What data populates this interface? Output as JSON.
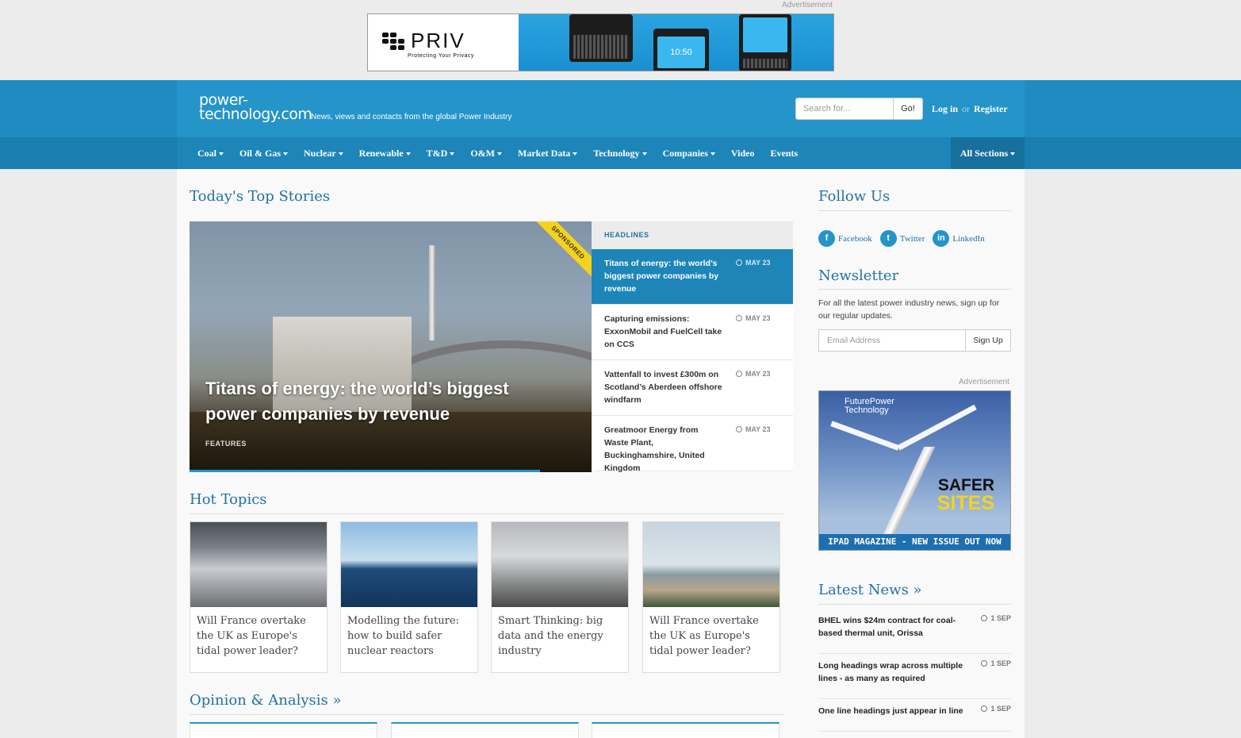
{
  "ad": {
    "label": "Advertisement",
    "brand": "PRIV",
    "tagline": "Protecting Your Privacy",
    "phone_time": "10:50"
  },
  "header": {
    "logo_line1": "power-",
    "logo_line2": "technology.com",
    "tagline": "News, views and contacts from the global Power Industry",
    "search_placeholder": "Search for...",
    "go_label": "Go!",
    "login": "Log in",
    "or": "or",
    "register": "Register"
  },
  "nav": {
    "items": [
      {
        "label": "Coal",
        "dropdown": true
      },
      {
        "label": "Oil & Gas",
        "dropdown": true
      },
      {
        "label": "Nuclear",
        "dropdown": true
      },
      {
        "label": "Renewable",
        "dropdown": true
      },
      {
        "label": "T&D",
        "dropdown": true
      },
      {
        "label": "O&M",
        "dropdown": true
      },
      {
        "label": "Market Data",
        "dropdown": true
      },
      {
        "label": "Technology",
        "dropdown": true
      },
      {
        "label": "Companies",
        "dropdown": true
      },
      {
        "label": "Video",
        "dropdown": false
      },
      {
        "label": "Events",
        "dropdown": false
      }
    ],
    "all_sections": "All Sections"
  },
  "main": {
    "top_stories_title": "Today's Top Stories",
    "hero": {
      "title": "Titans of energy: the world’s biggest power companies by revenue",
      "category": "FEATURES",
      "badge": "SPONSORED"
    },
    "headlines": {
      "heading": "HEADLINES",
      "items": [
        {
          "title": "Titans of energy: the world’s biggest power companies by revenue",
          "date": "MAY 23",
          "active": true
        },
        {
          "title": "Capturing emissions: ExxonMobil and FuelCell take on CCS",
          "date": "MAY 23",
          "active": false
        },
        {
          "title": "Vattenfall to invest £300m on Scotland’s Aberdeen offshore windfarm",
          "date": "MAY 23",
          "active": false
        },
        {
          "title": "Greatmoor Energy from Waste Plant, Buckinghamshire, United Kingdom",
          "date": "MAY 23",
          "active": false
        }
      ]
    },
    "hot_topics_title": "Hot Topics",
    "hot_topics": [
      {
        "title": "Will France overtake the UK as Europe's tidal power leader?"
      },
      {
        "title": "Modelling the future: how to build safer nuclear reactors"
      },
      {
        "title": "Smart Thinking: big data and the energy industry"
      },
      {
        "title": "Will France overtake the UK as Europe's tidal power leader?"
      }
    ],
    "opinion_title": "Opinion & Analysis »"
  },
  "sidebar": {
    "follow_title": "Follow Us",
    "social": [
      {
        "label": "Facebook",
        "icon": "facebook-icon",
        "glyph": "f"
      },
      {
        "label": "Twitter",
        "icon": "twitter-icon",
        "glyph": "t"
      },
      {
        "label": "LinkedIn",
        "icon": "linkedin-icon",
        "glyph": "in"
      }
    ],
    "newsletter_title": "Newsletter",
    "newsletter_text": "For all the latest power industry news, sign up for our regular updates.",
    "email_placeholder": "Email Address",
    "signup_label": "Sign Up",
    "ad_label": "Advertisement",
    "magazine": {
      "brand_line1": "FuturePower",
      "brand_line2": "Technology",
      "headline1": "SAFER",
      "headline2": "SITES",
      "banner": "IPAD MAGAZINE - NEW ISSUE OUT NOW"
    },
    "latest_title": "Latest News »",
    "latest": [
      {
        "title": "BHEL wins $24m contract for coal-based thermal unit, Orissa",
        "date": "1 SEP"
      },
      {
        "title": "Long headings wrap across multiple lines - as many as required",
        "date": "1 SEP"
      },
      {
        "title": "One line headings just appear in line",
        "date": "1 SEP"
      }
    ]
  },
  "colors": {
    "brand_blue": "#2494c9",
    "nav_blue": "#1d85b8",
    "title_blue": "#2272a6",
    "sponsored_yellow": "#f5d21e"
  }
}
